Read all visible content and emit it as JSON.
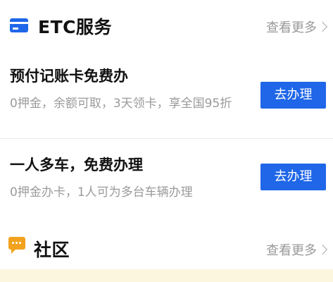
{
  "etc_section": {
    "icon": "etc-card-icon",
    "title": "ETC服务",
    "more_label": "查看更多"
  },
  "cards": [
    {
      "title": "预付记账卡免费办",
      "description": "0押金，余额可取，3天领卡，享全国95折",
      "button_label": "去办理"
    },
    {
      "title": "一人多车，免费办理",
      "description": "0押金办卡，1人可为多台车辆办理",
      "button_label": "去办理"
    }
  ],
  "community_section": {
    "icon": "chat-bubble-icon",
    "title": "社区",
    "more_label": "查看更多"
  },
  "colors": {
    "primary_blue": "#1f66e8",
    "community_orange": "#f2a21d",
    "muted_text": "#9a9a9a",
    "title_text": "#111111"
  }
}
